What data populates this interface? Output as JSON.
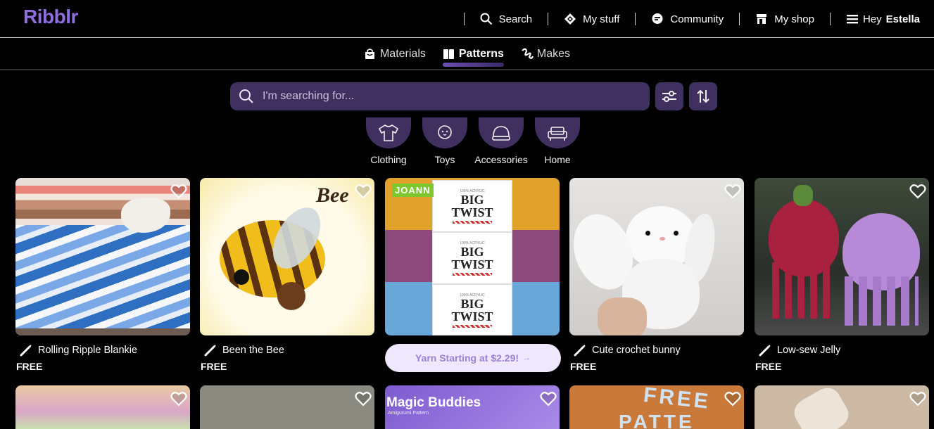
{
  "app": {
    "logo": "Ribblr"
  },
  "topnav": {
    "search": "Search",
    "my_stuff": "My stuff",
    "community": "Community",
    "my_shop": "My shop",
    "greeting": "Hey",
    "user": "Estella"
  },
  "subnav": [
    {
      "label": "Materials",
      "icon": "bag-icon",
      "active": false
    },
    {
      "label": "Patterns",
      "icon": "book-icon",
      "active": true
    },
    {
      "label": "Makes",
      "icon": "yarn-stitch-icon",
      "active": false
    }
  ],
  "search": {
    "placeholder": "I'm searching for..."
  },
  "categories": [
    "Clothing",
    "Toys",
    "Accessories",
    "Home"
  ],
  "cards": [
    {
      "title": "Rolling Ripple Blankie",
      "price": "FREE"
    },
    {
      "title": "Been the Bee",
      "price": "FREE",
      "overlay_text": "Bee"
    },
    {
      "ad_badge": "JOANN",
      "yarn_label": "BIG TWIST",
      "yarn_brand": "100% ACRYLIC",
      "promo": "Yarn Starting at $2.29!",
      "promo_arrow": "→"
    },
    {
      "title": "Cute crochet bunny",
      "price": "FREE"
    },
    {
      "title": "Low-sew Jelly",
      "price": "FREE"
    }
  ],
  "row2": [
    {
      "overlay_text": ""
    },
    {
      "overlay_text": ""
    },
    {
      "overlay_text": "Magic Buddies",
      "overlay_sub": "Amigurumi Pattern"
    },
    {
      "overlay_text": "FREE",
      "overlay_sub": "PATTE"
    },
    {
      "overlay_text": ""
    }
  ],
  "colors": {
    "accent": "#8f6ee0",
    "panel": "#40305f",
    "promo_bg": "#efe7fb",
    "joann": "#7ec72e"
  }
}
